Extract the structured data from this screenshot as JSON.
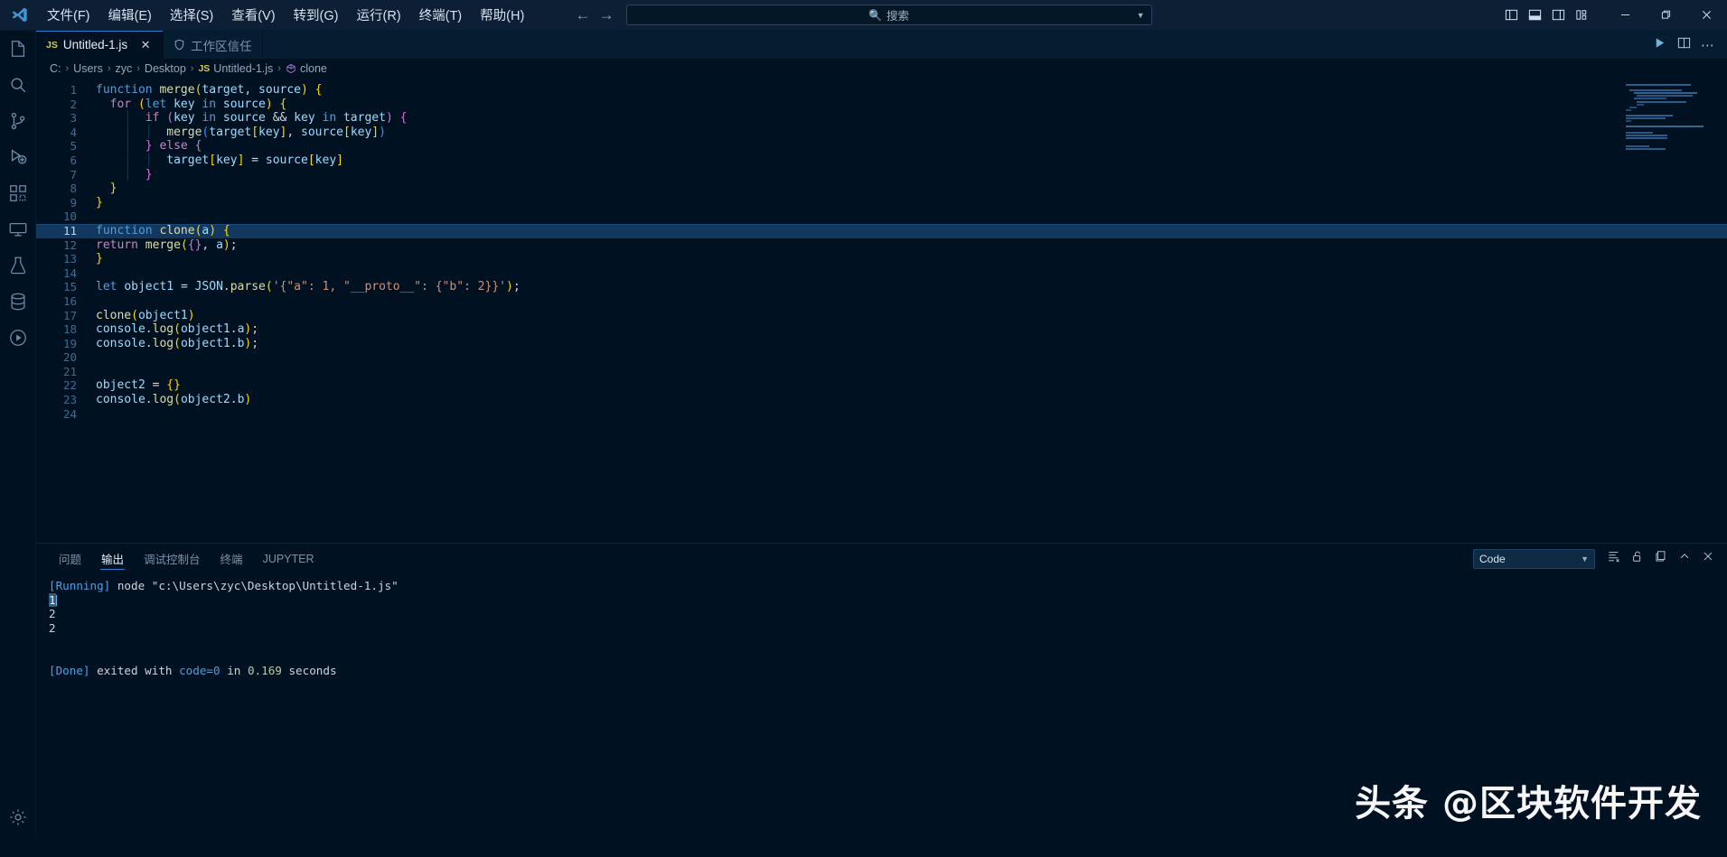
{
  "titlebar": {
    "logo_icon": "vscode-logo-icon",
    "menus": [
      {
        "label": "文件(F)"
      },
      {
        "label": "编辑(E)"
      },
      {
        "label": "选择(S)"
      },
      {
        "label": "查看(V)"
      },
      {
        "label": "转到(G)"
      },
      {
        "label": "运行(R)"
      },
      {
        "label": "终端(T)"
      },
      {
        "label": "帮助(H)"
      }
    ],
    "nav_back_icon": "arrow-left-icon",
    "nav_forward_icon": "arrow-right-icon",
    "search": {
      "placeholder": "搜索",
      "value": "",
      "icon": "search-icon",
      "dropdown_icon": "chevron-down-icon"
    },
    "layout_icons": [
      {
        "name": "toggle-primary-sidebar-icon"
      },
      {
        "name": "toggle-panel-icon"
      },
      {
        "name": "toggle-secondary-sidebar-icon"
      },
      {
        "name": "customize-layout-icon"
      }
    ],
    "window_controls": [
      {
        "name": "minimize-button",
        "glyph": "—"
      },
      {
        "name": "maximize-button",
        "glyph": "❐"
      },
      {
        "name": "close-button",
        "glyph": "✕"
      }
    ]
  },
  "activitybar": {
    "items": [
      {
        "name": "explorer",
        "icon": "files-icon"
      },
      {
        "name": "search",
        "icon": "search-icon"
      },
      {
        "name": "source-control",
        "icon": "source-control-icon"
      },
      {
        "name": "run-and-debug",
        "icon": "debug-play-icon"
      },
      {
        "name": "extensions",
        "icon": "extensions-icon"
      },
      {
        "name": "remote-explorer",
        "icon": "remote-explorer-icon"
      },
      {
        "name": "testing",
        "icon": "beaker-icon"
      },
      {
        "name": "database",
        "icon": "database-icon"
      },
      {
        "name": "code-runner",
        "icon": "circle-play-icon"
      }
    ],
    "bottom": [
      {
        "name": "settings",
        "icon": "gear-icon"
      }
    ]
  },
  "tabs": {
    "items": [
      {
        "label": "Untitled-1.js",
        "icon": "js-file-icon",
        "active": true,
        "close_icon": "close-icon"
      },
      {
        "label": "工作区信任",
        "icon": "shield-icon",
        "active": false
      }
    ],
    "actions": [
      {
        "name": "run-code-button",
        "icon": "play-icon"
      },
      {
        "name": "split-editor-button",
        "icon": "split-editor-icon"
      },
      {
        "name": "more-actions-button",
        "icon": "ellipsis-icon",
        "glyph": "⋯"
      }
    ]
  },
  "breadcrumb": {
    "items": [
      {
        "label": "C:"
      },
      {
        "label": "Users"
      },
      {
        "label": "zyc"
      },
      {
        "label": "Desktop"
      },
      {
        "label": "Untitled-1.js",
        "icon": "js-file-icon"
      },
      {
        "label": "clone",
        "icon": "symbol-function-icon"
      }
    ],
    "separator": "›"
  },
  "editor": {
    "filename": "Untitled-1.js",
    "language": "javascript",
    "current_line": 11,
    "total_lines": 24,
    "lines": [
      {
        "n": 1,
        "text": "function merge(target, source) {"
      },
      {
        "n": 2,
        "text": "  for (let key in source) {"
      },
      {
        "n": 3,
        "text": "      if (key in source && key in target) {"
      },
      {
        "n": 4,
        "text": "          merge(target[key], source[key])"
      },
      {
        "n": 5,
        "text": "      } else {"
      },
      {
        "n": 6,
        "text": "          target[key] = source[key]"
      },
      {
        "n": 7,
        "text": "      }"
      },
      {
        "n": 8,
        "text": "  }"
      },
      {
        "n": 9,
        "text": "}"
      },
      {
        "n": 10,
        "text": ""
      },
      {
        "n": 11,
        "text": "function clone(a) {"
      },
      {
        "n": 12,
        "text": "return merge({}, a);"
      },
      {
        "n": 13,
        "text": "}"
      },
      {
        "n": 14,
        "text": ""
      },
      {
        "n": 15,
        "text": "let object1 = JSON.parse('{\"a\": 1, \"__proto__\": {\"b\": 2}}');"
      },
      {
        "n": 16,
        "text": ""
      },
      {
        "n": 17,
        "text": "clone(object1)"
      },
      {
        "n": 18,
        "text": "console.log(object1.a);"
      },
      {
        "n": 19,
        "text": "console.log(object1.b);"
      },
      {
        "n": 20,
        "text": ""
      },
      {
        "n": 21,
        "text": ""
      },
      {
        "n": 22,
        "text": "object2 = {}"
      },
      {
        "n": 23,
        "text": "console.log(object2.b)"
      },
      {
        "n": 24,
        "text": ""
      }
    ]
  },
  "panel": {
    "tabs": [
      {
        "label": "问题",
        "active": false
      },
      {
        "label": "输出",
        "active": true
      },
      {
        "label": "调试控制台",
        "active": false
      },
      {
        "label": "终端",
        "active": false
      },
      {
        "label": "JUPYTER",
        "active": false
      }
    ],
    "channel_select": {
      "value": "Code",
      "dropdown_icon": "chevron-down-icon"
    },
    "actions": [
      {
        "name": "clear-output-button",
        "icon": "clear-all-icon"
      },
      {
        "name": "turn-auto-scrolling-off-button",
        "icon": "unlock-icon"
      },
      {
        "name": "open-in-editor-button",
        "icon": "open-editor-icon"
      },
      {
        "name": "maximize-panel-button",
        "icon": "chevron-up-icon"
      },
      {
        "name": "close-panel-button",
        "icon": "close-icon"
      }
    ],
    "output": {
      "running_tag": "[Running]",
      "running_command": "node \"c:\\Users\\zyc\\Desktop\\Untitled-1.js\"",
      "results": [
        "1",
        "2",
        "2"
      ],
      "done_tag": "[Done]",
      "done_prefix": "exited with",
      "done_code": "code=0",
      "done_middle": "in",
      "done_time": "0.169",
      "done_suffix": "seconds"
    }
  },
  "watermark": {
    "text": "头条 @区块软件开发"
  },
  "colors": {
    "background": "#001122",
    "accent": "#2b7fd4",
    "current_line": "#12385f",
    "keyword": "#569cd6",
    "function": "#dcdcaa",
    "string": "#ce9178",
    "number": "#b5cea8"
  }
}
